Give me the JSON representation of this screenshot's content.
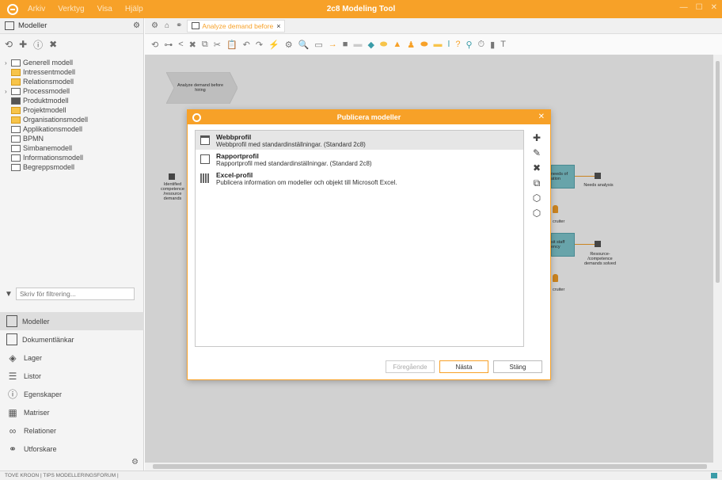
{
  "app": {
    "title": "2c8 Modeling Tool",
    "menu": [
      "Arkiv",
      "Verktyg",
      "Visa",
      "Hjälp"
    ]
  },
  "left_panel": {
    "title": "Modeller",
    "tree": [
      {
        "label": "Generell modell",
        "expandable": true
      },
      {
        "label": "Intressentmodell",
        "expandable": false
      },
      {
        "label": "Relationsmodell",
        "expandable": false
      },
      {
        "label": "Processmodell",
        "expandable": true
      },
      {
        "label": "Produktmodell",
        "expandable": false
      },
      {
        "label": "Projektmodell",
        "expandable": false
      },
      {
        "label": "Organisationsmodell",
        "expandable": false
      },
      {
        "label": "Applikationsmodell",
        "expandable": false
      },
      {
        "label": "BPMN",
        "expandable": false
      },
      {
        "label": "Simbanemodell",
        "expandable": false
      },
      {
        "label": "Informationsmodell",
        "expandable": false
      },
      {
        "label": "Begreppsmodell",
        "expandable": false
      }
    ],
    "filter_placeholder": "Skriv för filtrering...",
    "nav": [
      "Modeller",
      "Dokumentlänkar",
      "Lager",
      "Listor",
      "Egenskaper",
      "Matriser",
      "Relationer",
      "Utforskare"
    ]
  },
  "editor": {
    "tab_label": "Analyze demand before",
    "diagram": {
      "start_label": "Analyze demand before hiring",
      "left_label": "Identified competence /resource demands",
      "box1_label": "needs of ation",
      "box2_label": "sit staff ency",
      "out1_label": "Needs analysis",
      "out2_label": "Resource- /competence demands solved",
      "role_label": "cruiter"
    }
  },
  "dialog": {
    "title": "Publicera modeller",
    "profiles": [
      {
        "name": "Webbprofil",
        "desc": "Webbprofil med standardinställningar. (Standard 2c8)"
      },
      {
        "name": "Rapportprofil",
        "desc": "Rapportprofil med standardinställningar. (Standard 2c8)"
      },
      {
        "name": "Excel-profil",
        "desc": "Publicera information om modeller och objekt till Microsoft Excel."
      }
    ],
    "buttons": {
      "prev": "Föregående",
      "next": "Nästa",
      "close": "Stäng"
    }
  },
  "status": {
    "text": "TOVE KROON | TIPS MODELLERINGSFORUM |"
  }
}
